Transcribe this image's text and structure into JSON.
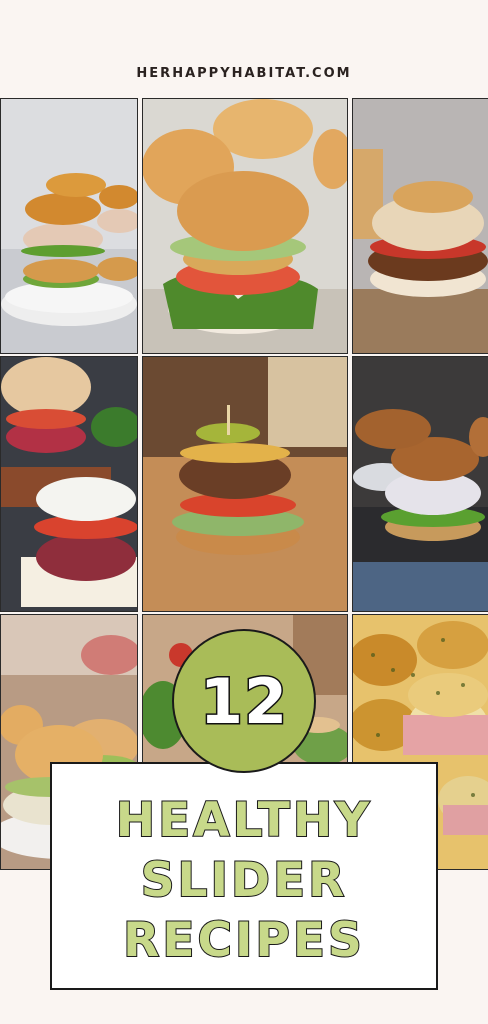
{
  "header": {
    "site": "HERHAPPYHABITAT.COM"
  },
  "badge": {
    "count": "12"
  },
  "title": {
    "line1": "HEALTHY",
    "line2": "SLIDER",
    "line3": "RECIPES"
  },
  "photos": [
    "salmon-slider-photo",
    "avocado-burger-slider-photo",
    "roasted-pepper-slider-photo",
    "beet-tzatziki-slider-photo",
    "pickle-cheeseburger-slider-photo",
    "chicken-salad-slider-photo",
    "coleslaw-slider-photo",
    "veggie-slider-photo",
    "ham-swiss-slider-photo"
  ],
  "colors": {
    "accent": "#a9bc58",
    "title_fill": "#c8d98a",
    "background": "#faf5f2"
  }
}
